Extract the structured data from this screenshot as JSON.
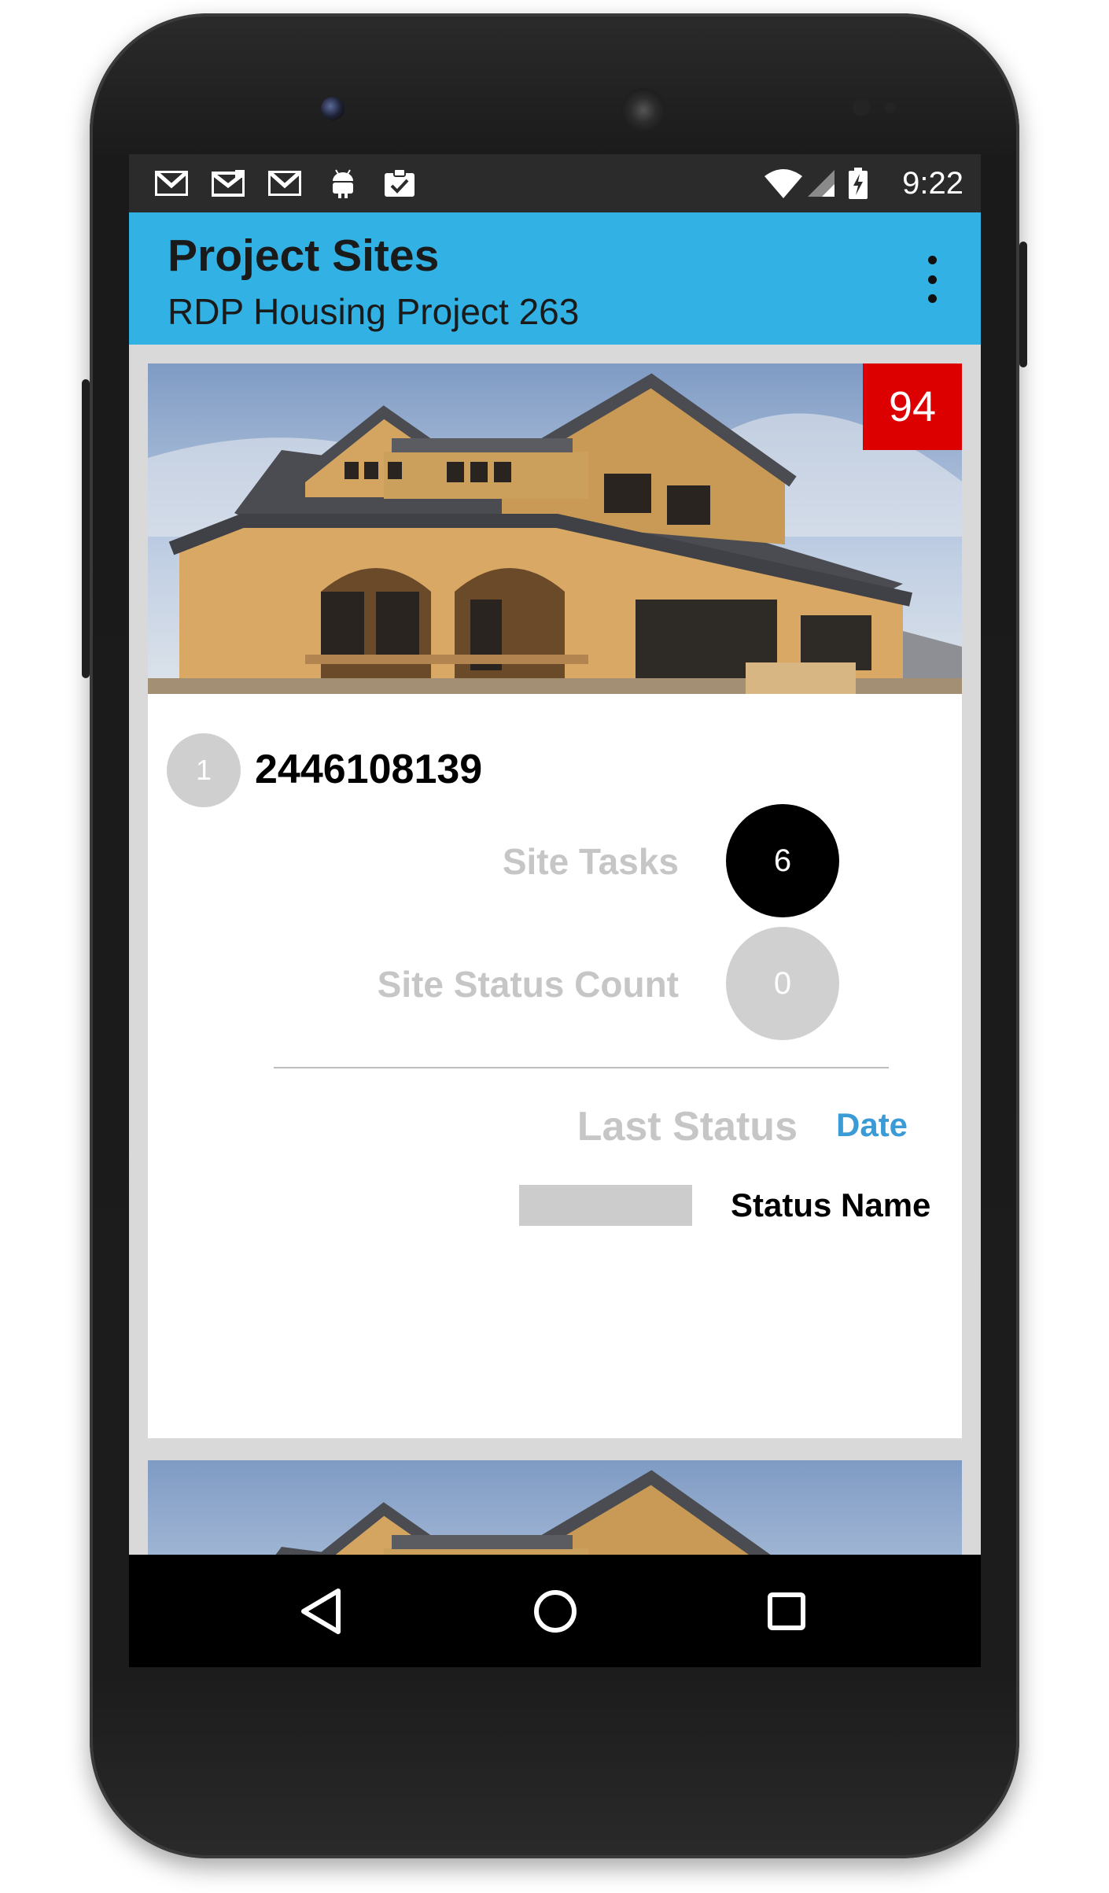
{
  "status_bar": {
    "time": "9:22",
    "icons": [
      "gmail-icon",
      "gmail-icon",
      "gmail-icon",
      "android-icon",
      "clipboard-check-icon",
      "wifi-icon",
      "signal-icon",
      "battery-charging-icon"
    ]
  },
  "app_bar": {
    "title": "Project Sites",
    "subtitle": "RDP Housing Project 263"
  },
  "cards": [
    {
      "score": "94",
      "index": "1",
      "site_id": "2446108139",
      "site_tasks_label": "Site Tasks",
      "site_tasks_count": "6",
      "site_status_count_label": "Site Status Count",
      "site_status_count": "0",
      "last_status_label": "Last Status",
      "date_label": "Date",
      "status_name": "Status Name"
    }
  ],
  "colors": {
    "app_bar": "#32b2e4",
    "score_badge": "#dd0000",
    "date_link": "#3a9bd6",
    "status_bar": "#2b2b2b"
  }
}
